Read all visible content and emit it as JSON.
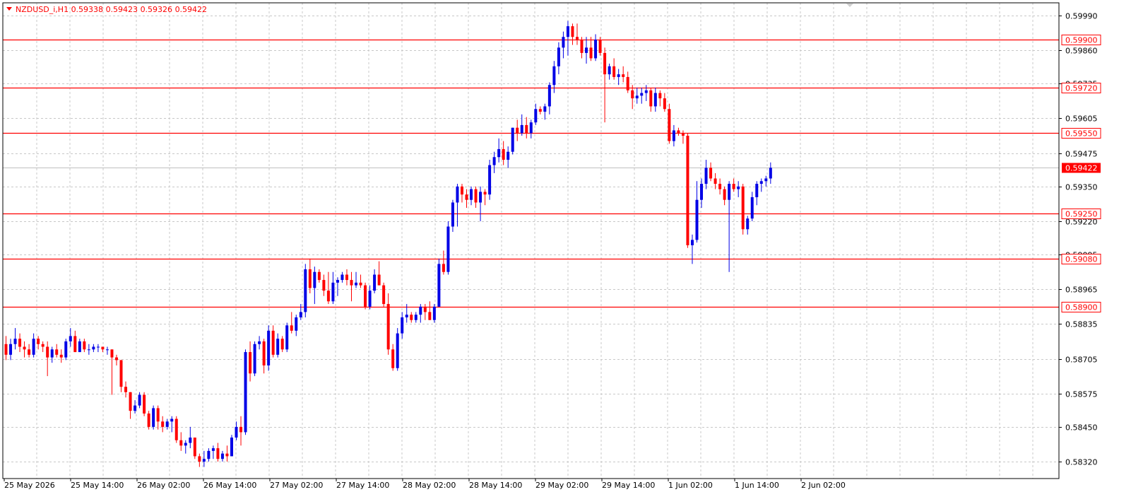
{
  "header": {
    "symbol": "NZDUSD_i,H1",
    "open": "0.59338",
    "high": "0.59423",
    "low": "0.59326",
    "close": "0.59422",
    "menu_icon": "triangle-down-icon"
  },
  "colors": {
    "background": "#ffffff",
    "frame": "#000000",
    "grid": "#c8c8c8",
    "bull": "#0000e6",
    "bear": "#ff0000",
    "level_line": "#ff0000",
    "level_tag_text": "#ff0000",
    "price_tag_bg": "#ff0000",
    "axis_text": "#000000",
    "header_text": "#ff0000"
  },
  "chart_data": {
    "type": "candlestick",
    "title": "NZDUSD_i,H1",
    "grid": true,
    "ylim": [
      0.5829,
      1.0
    ],
    "x_tick_labels": [
      "25 May 2026",
      "25 May 14:00",
      "26 May 02:00",
      "26 May 14:00",
      "27 May 02:00",
      "27 May 14:00",
      "28 May 02:00",
      "28 May 14:00",
      "29 May 02:00",
      "29 May 14:00",
      "1 Jun 02:00",
      "1 Jun 14:00",
      "2 Jun 02:00"
    ],
    "y_tick_labels": [
      "0.59990",
      "0.59860",
      "0.59735",
      "0.59605",
      "0.59475",
      "0.59350",
      "0.59220",
      "0.59095",
      "0.58965",
      "0.58835",
      "0.58705",
      "0.58575",
      "0.58450",
      "0.58320"
    ],
    "y_tick_values": [
      0.5999,
      0.5986,
      0.59735,
      0.59605,
      0.59475,
      0.5935,
      0.5922,
      0.59095,
      0.58965,
      0.58835,
      0.58705,
      0.58575,
      0.5845,
      0.5832
    ],
    "horizontal_levels": [
      {
        "value": 0.599,
        "label": "0.59900"
      },
      {
        "value": 0.5972,
        "label": "0.59720"
      },
      {
        "value": 0.5955,
        "label": "0.59550"
      },
      {
        "value": 0.5925,
        "label": "0.59250"
      },
      {
        "value": 0.5908,
        "label": "0.59080"
      },
      {
        "value": 0.589,
        "label": "0.58900"
      }
    ],
    "current_price": {
      "value": 0.59422,
      "label": "0.59422"
    },
    "candles_ohlc": [
      [
        0.5876,
        0.5879,
        0.587,
        0.5872
      ],
      [
        0.5872,
        0.5878,
        0.587,
        0.5876
      ],
      [
        0.5876,
        0.5882,
        0.5874,
        0.5878
      ],
      [
        0.5878,
        0.588,
        0.5873,
        0.5875
      ],
      [
        0.5875,
        0.5877,
        0.5871,
        0.5874
      ],
      [
        0.5874,
        0.5876,
        0.5871,
        0.5872
      ],
      [
        0.5872,
        0.588,
        0.5871,
        0.5878
      ],
      [
        0.5878,
        0.5879,
        0.5874,
        0.5876
      ],
      [
        0.5876,
        0.5877,
        0.5873,
        0.5875
      ],
      [
        0.5875,
        0.5877,
        0.5864,
        0.5871
      ],
      [
        0.5871,
        0.5875,
        0.5869,
        0.5874
      ],
      [
        0.5874,
        0.5876,
        0.5871,
        0.5872
      ],
      [
        0.5872,
        0.5874,
        0.5869,
        0.5871
      ],
      [
        0.5871,
        0.5878,
        0.587,
        0.5877
      ],
      [
        0.5877,
        0.5882,
        0.5875,
        0.5879
      ],
      [
        0.5879,
        0.5881,
        0.5873,
        0.5873
      ],
      [
        0.5873,
        0.5878,
        0.5873,
        0.5877
      ],
      [
        0.5877,
        0.5878,
        0.5873,
        0.5874
      ],
      [
        0.5874,
        0.5876,
        0.5872,
        0.5874
      ],
      [
        0.5874,
        0.5876,
        0.5873,
        0.5875
      ],
      [
        0.5875,
        0.5876,
        0.5873,
        0.5875
      ],
      [
        0.5875,
        0.5875,
        0.5873,
        0.5874
      ],
      [
        0.5874,
        0.5875,
        0.5872,
        0.5874
      ],
      [
        0.5874,
        0.5874,
        0.5857,
        0.5871
      ],
      [
        0.5871,
        0.5872,
        0.5868,
        0.587
      ],
      [
        0.587,
        0.587,
        0.5858,
        0.586
      ],
      [
        0.586,
        0.5862,
        0.5856,
        0.5858
      ],
      [
        0.5858,
        0.5858,
        0.5848,
        0.5851
      ],
      [
        0.5851,
        0.5855,
        0.585,
        0.5853
      ],
      [
        0.5853,
        0.5858,
        0.5852,
        0.5857
      ],
      [
        0.5857,
        0.5858,
        0.5849,
        0.585
      ],
      [
        0.585,
        0.5851,
        0.5844,
        0.5845
      ],
      [
        0.5845,
        0.5853,
        0.5844,
        0.5852
      ],
      [
        0.5852,
        0.5853,
        0.5844,
        0.5847
      ],
      [
        0.5847,
        0.5849,
        0.5843,
        0.5845
      ],
      [
        0.5845,
        0.5848,
        0.5844,
        0.5847
      ],
      [
        0.5847,
        0.5849,
        0.5843,
        0.5848
      ],
      [
        0.5848,
        0.5849,
        0.5839,
        0.584
      ],
      [
        0.584,
        0.5843,
        0.5836,
        0.5838
      ],
      [
        0.5838,
        0.584,
        0.5835,
        0.5839
      ],
      [
        0.5839,
        0.5845,
        0.5837,
        0.5841
      ],
      [
        0.5841,
        0.5841,
        0.5833,
        0.5834
      ],
      [
        0.5834,
        0.5835,
        0.583,
        0.5832
      ],
      [
        0.5832,
        0.5836,
        0.583,
        0.5833
      ],
      [
        0.5833,
        0.5837,
        0.5832,
        0.5836
      ],
      [
        0.5836,
        0.5838,
        0.5833,
        0.5837
      ],
      [
        0.5837,
        0.5839,
        0.5832,
        0.5833
      ],
      [
        0.5833,
        0.5836,
        0.5832,
        0.5835
      ],
      [
        0.5835,
        0.5838,
        0.5832,
        0.5834
      ],
      [
        0.5834,
        0.5842,
        0.5834,
        0.5841
      ],
      [
        0.5841,
        0.5847,
        0.584,
        0.5845
      ],
      [
        0.5845,
        0.5849,
        0.5838,
        0.5843
      ],
      [
        0.5843,
        0.5874,
        0.5842,
        0.5873
      ],
      [
        0.5873,
        0.5877,
        0.5862,
        0.5865
      ],
      [
        0.5865,
        0.5877,
        0.5864,
        0.5876
      ],
      [
        0.5876,
        0.5879,
        0.5874,
        0.5877
      ],
      [
        0.5877,
        0.5878,
        0.5865,
        0.5868
      ],
      [
        0.5868,
        0.5883,
        0.5866,
        0.5881
      ],
      [
        0.5881,
        0.5883,
        0.5871,
        0.5872
      ],
      [
        0.5872,
        0.588,
        0.5871,
        0.5878
      ],
      [
        0.5878,
        0.5879,
        0.5873,
        0.5874
      ],
      [
        0.5874,
        0.5884,
        0.5873,
        0.5883
      ],
      [
        0.5883,
        0.5888,
        0.588,
        0.5881
      ],
      [
        0.5881,
        0.5887,
        0.5879,
        0.5886
      ],
      [
        0.5886,
        0.5891,
        0.5885,
        0.5888
      ],
      [
        0.5888,
        0.5906,
        0.5886,
        0.5904
      ],
      [
        0.5904,
        0.5908,
        0.5895,
        0.5897
      ],
      [
        0.5897,
        0.5905,
        0.5891,
        0.5903
      ],
      [
        0.5903,
        0.5904,
        0.5899,
        0.59
      ],
      [
        0.59,
        0.5902,
        0.5894,
        0.5896
      ],
      [
        0.5896,
        0.5903,
        0.5891,
        0.5892
      ],
      [
        0.5892,
        0.5903,
        0.5891,
        0.5899
      ],
      [
        0.5899,
        0.5901,
        0.5894,
        0.59
      ],
      [
        0.59,
        0.5903,
        0.5899,
        0.5902
      ],
      [
        0.5902,
        0.5904,
        0.5898,
        0.59
      ],
      [
        0.59,
        0.5903,
        0.5892,
        0.5898
      ],
      [
        0.5898,
        0.5903,
        0.5897,
        0.5899
      ],
      [
        0.5899,
        0.5902,
        0.5897,
        0.5898
      ],
      [
        0.5898,
        0.5899,
        0.5889,
        0.589
      ],
      [
        0.589,
        0.5898,
        0.5889,
        0.5896
      ],
      [
        0.5896,
        0.5904,
        0.5895,
        0.5902
      ],
      [
        0.5902,
        0.5907,
        0.5898,
        0.5898
      ],
      [
        0.5898,
        0.5899,
        0.589,
        0.5891
      ],
      [
        0.5891,
        0.5895,
        0.5872,
        0.5874
      ],
      [
        0.5874,
        0.5876,
        0.5866,
        0.5867
      ],
      [
        0.5867,
        0.5882,
        0.5866,
        0.588
      ],
      [
        0.588,
        0.5888,
        0.5878,
        0.5886
      ],
      [
        0.5886,
        0.5891,
        0.5884,
        0.5887
      ],
      [
        0.5887,
        0.5888,
        0.5884,
        0.5885
      ],
      [
        0.5885,
        0.5888,
        0.5884,
        0.5887
      ],
      [
        0.5887,
        0.5891,
        0.5884,
        0.589
      ],
      [
        0.589,
        0.5891,
        0.5885,
        0.5888
      ],
      [
        0.5888,
        0.5892,
        0.5885,
        0.5885
      ],
      [
        0.5885,
        0.5891,
        0.5884,
        0.589
      ],
      [
        0.589,
        0.5908,
        0.589,
        0.5906
      ],
      [
        0.5906,
        0.5911,
        0.5902,
        0.5903
      ],
      [
        0.5903,
        0.5922,
        0.5902,
        0.592
      ],
      [
        0.592,
        0.593,
        0.5918,
        0.5929
      ],
      [
        0.5929,
        0.5936,
        0.592,
        0.5935
      ],
      [
        0.5935,
        0.5936,
        0.5929,
        0.5932
      ],
      [
        0.5932,
        0.5934,
        0.5927,
        0.593
      ],
      [
        0.593,
        0.5935,
        0.5928,
        0.5934
      ],
      [
        0.5934,
        0.5935,
        0.5927,
        0.5929
      ],
      [
        0.5929,
        0.5935,
        0.5922,
        0.5933
      ],
      [
        0.5933,
        0.5934,
        0.5928,
        0.5932
      ],
      [
        0.5932,
        0.5945,
        0.593,
        0.5943
      ],
      [
        0.5943,
        0.5948,
        0.594,
        0.5946
      ],
      [
        0.5946,
        0.5953,
        0.5944,
        0.5949
      ],
      [
        0.5949,
        0.5952,
        0.5943,
        0.5945
      ],
      [
        0.5945,
        0.595,
        0.5942,
        0.5948
      ],
      [
        0.5948,
        0.5957,
        0.5947,
        0.5957
      ],
      [
        0.5957,
        0.596,
        0.5952,
        0.5955
      ],
      [
        0.5955,
        0.5962,
        0.5954,
        0.5958
      ],
      [
        0.5958,
        0.5961,
        0.5953,
        0.5955
      ],
      [
        0.5955,
        0.596,
        0.5953,
        0.5959
      ],
      [
        0.5959,
        0.5966,
        0.5958,
        0.5964
      ],
      [
        0.5964,
        0.5965,
        0.5962,
        0.5963
      ],
      [
        0.5963,
        0.5966,
        0.596,
        0.5965
      ],
      [
        0.5965,
        0.5974,
        0.5962,
        0.5973
      ],
      [
        0.5973,
        0.5982,
        0.597,
        0.598
      ],
      [
        0.598,
        0.5989,
        0.5977,
        0.5987
      ],
      [
        0.5987,
        0.5993,
        0.5983,
        0.5991
      ],
      [
        0.5991,
        0.5997,
        0.5984,
        0.5995
      ],
      [
        0.5995,
        0.5996,
        0.5988,
        0.5991
      ],
      [
        0.5991,
        0.5996,
        0.5988,
        0.599
      ],
      [
        0.599,
        0.5991,
        0.5983,
        0.5985
      ],
      [
        0.5985,
        0.5991,
        0.5981,
        0.5987
      ],
      [
        0.5987,
        0.5991,
        0.5982,
        0.5983
      ],
      [
        0.5983,
        0.5992,
        0.5982,
        0.599
      ],
      [
        0.599,
        0.5991,
        0.5984,
        0.5985
      ],
      [
        0.5985,
        0.5987,
        0.5959,
        0.5977
      ],
      [
        0.5977,
        0.5981,
        0.5975,
        0.598
      ],
      [
        0.598,
        0.5983,
        0.5975,
        0.5976
      ],
      [
        0.5976,
        0.5979,
        0.5973,
        0.5977
      ],
      [
        0.5977,
        0.598,
        0.5974,
        0.5976
      ],
      [
        0.5976,
        0.5978,
        0.597,
        0.5971
      ],
      [
        0.5971,
        0.5973,
        0.5964,
        0.5968
      ],
      [
        0.5968,
        0.5972,
        0.5966,
        0.5969
      ],
      [
        0.5969,
        0.5972,
        0.5966,
        0.597
      ],
      [
        0.597,
        0.5973,
        0.5967,
        0.5971
      ],
      [
        0.5971,
        0.5972,
        0.5963,
        0.5965
      ],
      [
        0.5965,
        0.5972,
        0.5963,
        0.597
      ],
      [
        0.597,
        0.5971,
        0.5965,
        0.5968
      ],
      [
        0.5968,
        0.597,
        0.5963,
        0.5964
      ],
      [
        0.5964,
        0.5966,
        0.5951,
        0.5952
      ],
      [
        0.5952,
        0.5958,
        0.595,
        0.5956
      ],
      [
        0.5956,
        0.5957,
        0.5954,
        0.5955
      ],
      [
        0.5955,
        0.5956,
        0.5951,
        0.5954
      ],
      [
        0.5954,
        0.5955,
        0.5912,
        0.5913
      ],
      [
        0.5913,
        0.5917,
        0.5906,
        0.5915
      ],
      [
        0.5915,
        0.5937,
        0.5914,
        0.593
      ],
      [
        0.593,
        0.5938,
        0.5927,
        0.5936
      ],
      [
        0.5936,
        0.5945,
        0.5934,
        0.5942
      ],
      [
        0.5942,
        0.5944,
        0.5937,
        0.5938
      ],
      [
        0.5938,
        0.594,
        0.5934,
        0.5936
      ],
      [
        0.5936,
        0.5938,
        0.5932,
        0.5934
      ],
      [
        0.5934,
        0.5935,
        0.5928,
        0.593
      ],
      [
        0.593,
        0.5937,
        0.5903,
        0.5936
      ],
      [
        0.5936,
        0.5938,
        0.5933,
        0.5934
      ],
      [
        0.5934,
        0.5937,
        0.5931,
        0.5935
      ],
      [
        0.5935,
        0.5936,
        0.5917,
        0.5919
      ],
      [
        0.5919,
        0.5924,
        0.5917,
        0.5923
      ],
      [
        0.5923,
        0.5933,
        0.5922,
        0.5931
      ],
      [
        0.5931,
        0.5937,
        0.5928,
        0.5936
      ],
      [
        0.5936,
        0.5938,
        0.5933,
        0.5937
      ],
      [
        0.5937,
        0.5939,
        0.5935,
        0.5938
      ],
      [
        0.5938,
        0.5944,
        0.5936,
        0.5942
      ]
    ]
  }
}
